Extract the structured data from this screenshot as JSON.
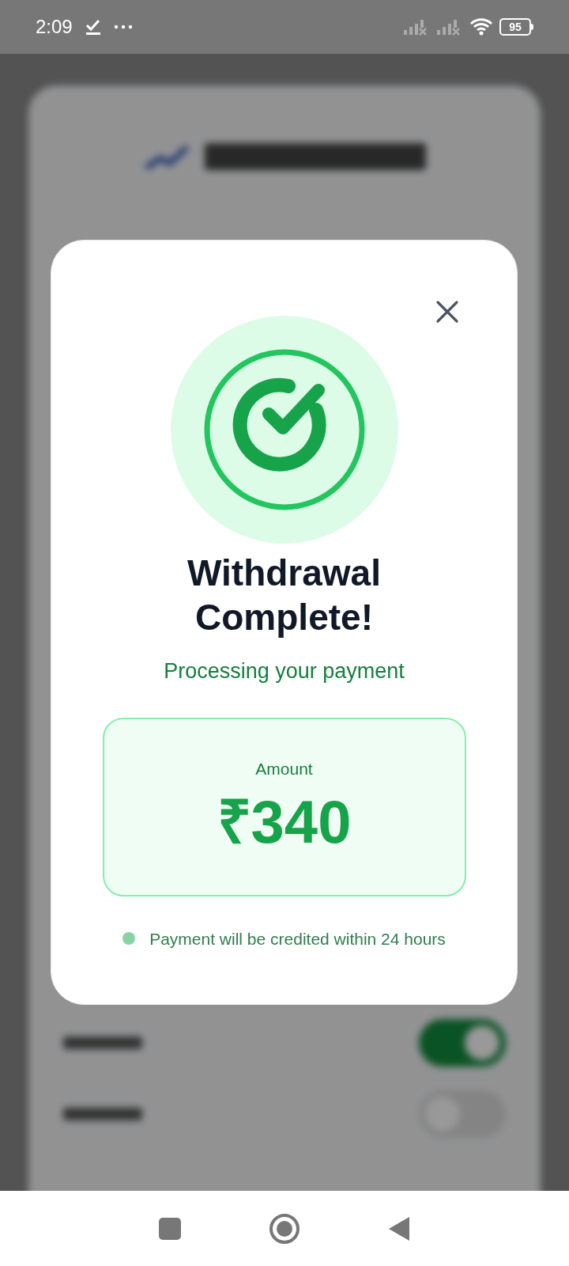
{
  "status_bar": {
    "time": "2:09",
    "battery": "95"
  },
  "background": {
    "toggles": [
      {
        "on": true
      },
      {
        "on": false
      }
    ]
  },
  "dialog": {
    "title": "Withdrawal Complete!",
    "subtitle": "Processing your payment",
    "amount_label": "Amount",
    "amount": "₹340",
    "note": "Payment will be credited within 24 hours"
  }
}
